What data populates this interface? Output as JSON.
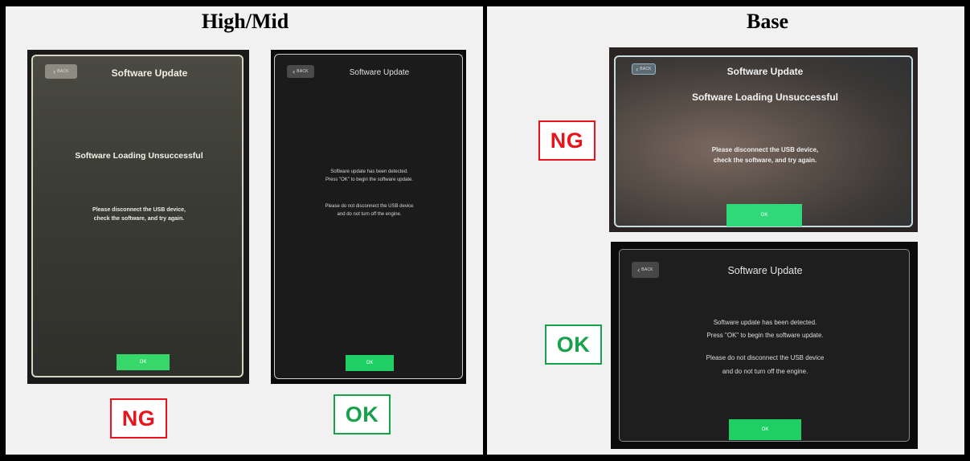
{
  "sections": {
    "high_mid": {
      "title": "High/Mid"
    },
    "base": {
      "title": "Base"
    }
  },
  "labels": {
    "ng": "NG",
    "ok": "OK"
  },
  "screens": {
    "back_label": "BACK",
    "title": "Software Update",
    "error_heading": "Software Loading Unsuccessful",
    "error_msg_1": "Please disconnect the USB device,",
    "error_msg_2": "check the software, and try again.",
    "detected_1": "Software update has been detected.",
    "detected_2": "Press \"OK\" to begin the software update.",
    "warn_1": "Please do not disconnect the USB device",
    "warn_2": "and do not turn off the engine.",
    "ok_button": "OK"
  },
  "colors": {
    "ng": "#e8131b",
    "ok": "#15a24a",
    "ok_button": "#1fcf64"
  }
}
